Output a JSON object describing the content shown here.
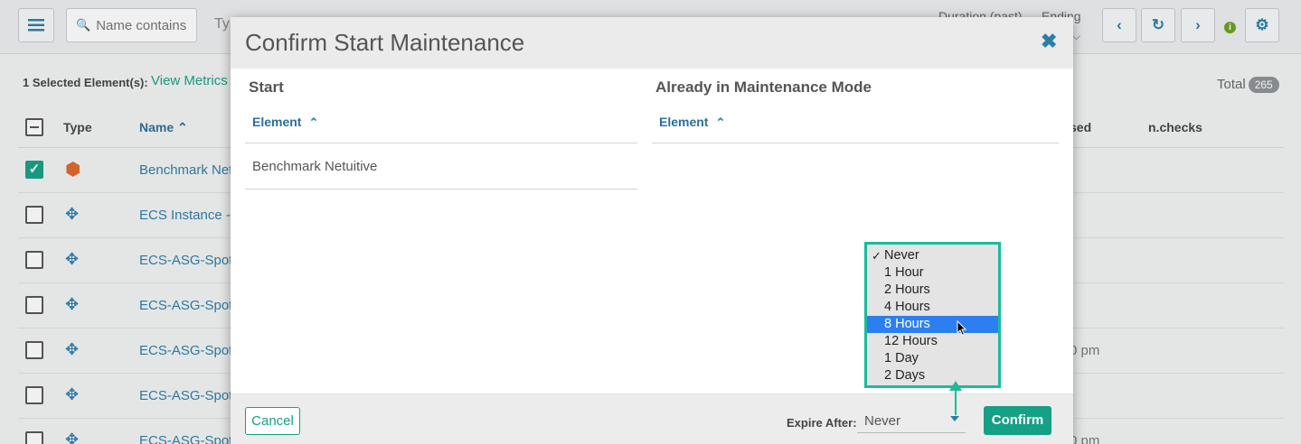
{
  "background": {
    "search_placeholder": "Name contains",
    "type_filter": "Ty",
    "duration_label": "Duration (past)",
    "ending_label": "Ending",
    "selected_text": "1 Selected Element(s):",
    "view_metrics": "View Metrics",
    "total_label": "Total",
    "total_count": "265",
    "columns": {
      "type": "Type",
      "name": "Name",
      "used": "sed",
      "checks": "n.checks"
    },
    "rows": [
      {
        "name": "Benchmark Net",
        "extra": ""
      },
      {
        "name": "ECS Instance - E",
        "extra": ""
      },
      {
        "name": "ECS-ASG-Spot-E",
        "extra": ""
      },
      {
        "name": "ECS-ASG-Spot-F",
        "extra": ""
      },
      {
        "name": "ECS-ASG-Spot-T",
        "extra": "0 pm"
      },
      {
        "name": "ECS-ASG-Spot-W",
        "extra": ""
      },
      {
        "name": "ECS-ASG-Spot-V",
        "extra": "0 pm"
      }
    ]
  },
  "modal": {
    "title": "Confirm Start Maintenance",
    "start_section": "Start",
    "already_section": "Already in Maintenance Mode",
    "element_header": "Element",
    "start_rows": [
      "Benchmark Netuitive"
    ],
    "cancel_label": "Cancel",
    "expire_label": "Expire After:",
    "expire_value": "Never",
    "confirm_label": "Confirm"
  },
  "dropdown": {
    "options": [
      "Never",
      "1 Hour",
      "2 Hours",
      "4 Hours",
      "8 Hours",
      "12 Hours",
      "1 Day",
      "2 Days"
    ],
    "checked": "Never",
    "highlighted": "8 Hours"
  },
  "colors": {
    "accent": "#16a085",
    "link": "#2a7fa8",
    "annotation": "#1abc9c",
    "highlight": "#2d7ff0"
  }
}
